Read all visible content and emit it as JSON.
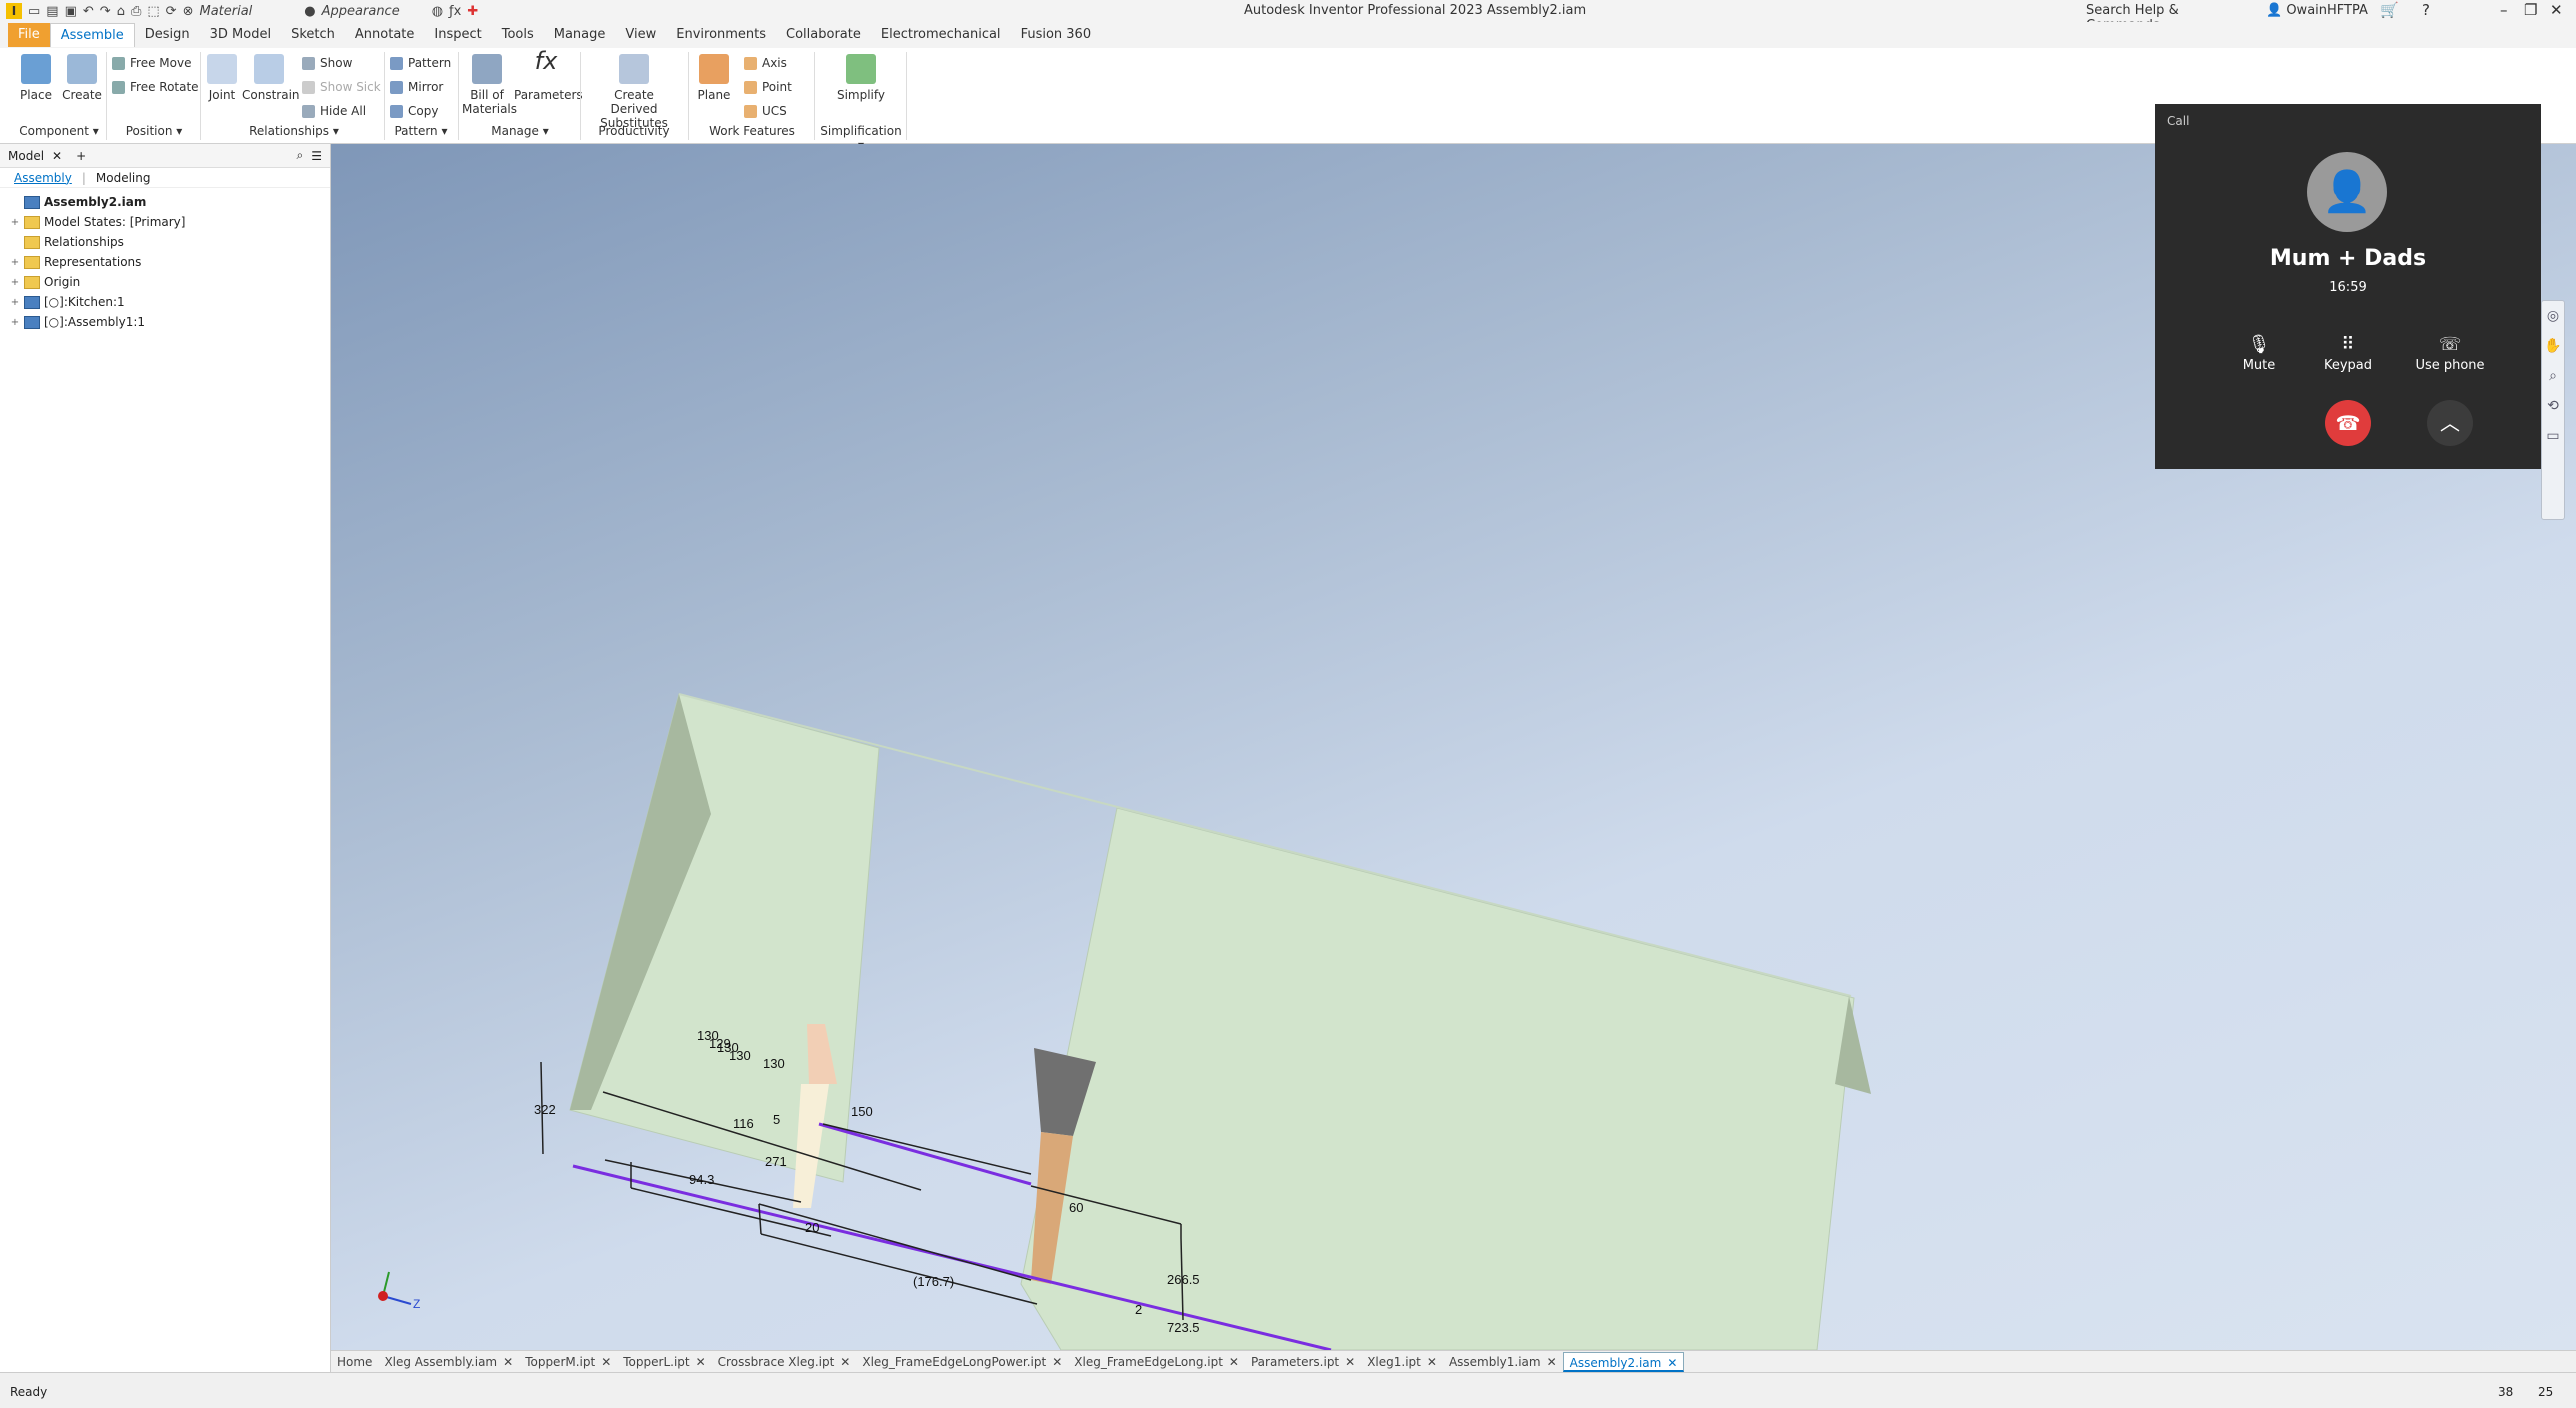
{
  "titlebar": {
    "app_title": "Autodesk Inventor Professional 2023   Assembly2.iam",
    "material": "Material",
    "appearance": "Appearance",
    "search_placeholder": "Search Help & Commands...",
    "user": "OwainHFTPA"
  },
  "menu_tabs": [
    "File",
    "Assemble",
    "Design",
    "3D Model",
    "Sketch",
    "Annotate",
    "Inspect",
    "Tools",
    "Manage",
    "View",
    "Environments",
    "Collaborate",
    "Electromechanical",
    "Fusion 360"
  ],
  "active_tab": "Assemble",
  "ribbon": {
    "place": "Place",
    "create": "Create",
    "free_move": "Free Move",
    "free_rotate": "Free Rotate",
    "joint": "Joint",
    "constrain": "Constrain",
    "show": "Show",
    "show_sick": "Show Sick",
    "hide_all": "Hide All",
    "pattern": "Pattern",
    "mirror": "Mirror",
    "copy": "Copy",
    "bom1": "Bill of",
    "bom2": "Materials",
    "parameters": "Parameters",
    "derived1": "Create Derived",
    "derived2": "Substitutes",
    "plane": "Plane",
    "axis": "Axis",
    "point": "Point",
    "ucs": "UCS",
    "simplify": "Simplify",
    "groups": {
      "component": "Component",
      "position": "Position",
      "relationships": "Relationships",
      "pattern": "Pattern",
      "manage": "Manage",
      "productivity": "Productivity",
      "work_features": "Work Features",
      "simplification": "Simplification"
    }
  },
  "browser": {
    "tab": "Model",
    "sub_assembly": "Assembly",
    "sub_modeling": "Modeling",
    "root": "Assembly2.iam",
    "nodes": [
      "Model States: [Primary]",
      "Relationships",
      "Representations",
      "Origin",
      "[○]:Kitchen:1",
      "[○]:Assembly1:1"
    ]
  },
  "dimensions": [
    "130",
    "129",
    "130",
    "130",
    "130",
    "322",
    "116",
    "5",
    "150",
    "271",
    "94.3",
    "20",
    "60",
    "(176.7)",
    "266.5",
    "2",
    "723.5"
  ],
  "doc_tabs": [
    "Home",
    "Xleg Assembly.iam",
    "TopperM.ipt",
    "TopperL.ipt",
    "Crossbrace Xleg.ipt",
    "Xleg_FrameEdgeLongPower.ipt",
    "Xleg_FrameEdgeLong.ipt",
    "Parameters.ipt",
    "Xleg1.ipt",
    "Assembly1.iam",
    "Assembly2.iam"
  ],
  "active_doc": "Assembly2.iam",
  "status": {
    "text": "Ready",
    "num1": "38",
    "num2": "25"
  },
  "call": {
    "header": "Call",
    "name": "Mum + Dads",
    "time": "16:59",
    "mute": "Mute",
    "keypad": "Keypad",
    "use_phone": "Use phone"
  },
  "colors": {
    "accent": "#0072c6",
    "file_tab": "#f0a030",
    "hangup": "#e03c3c",
    "call_bg": "#2b2b2b",
    "cabinet": "#d2e4cc",
    "dimension_line": "#7a2de0"
  }
}
